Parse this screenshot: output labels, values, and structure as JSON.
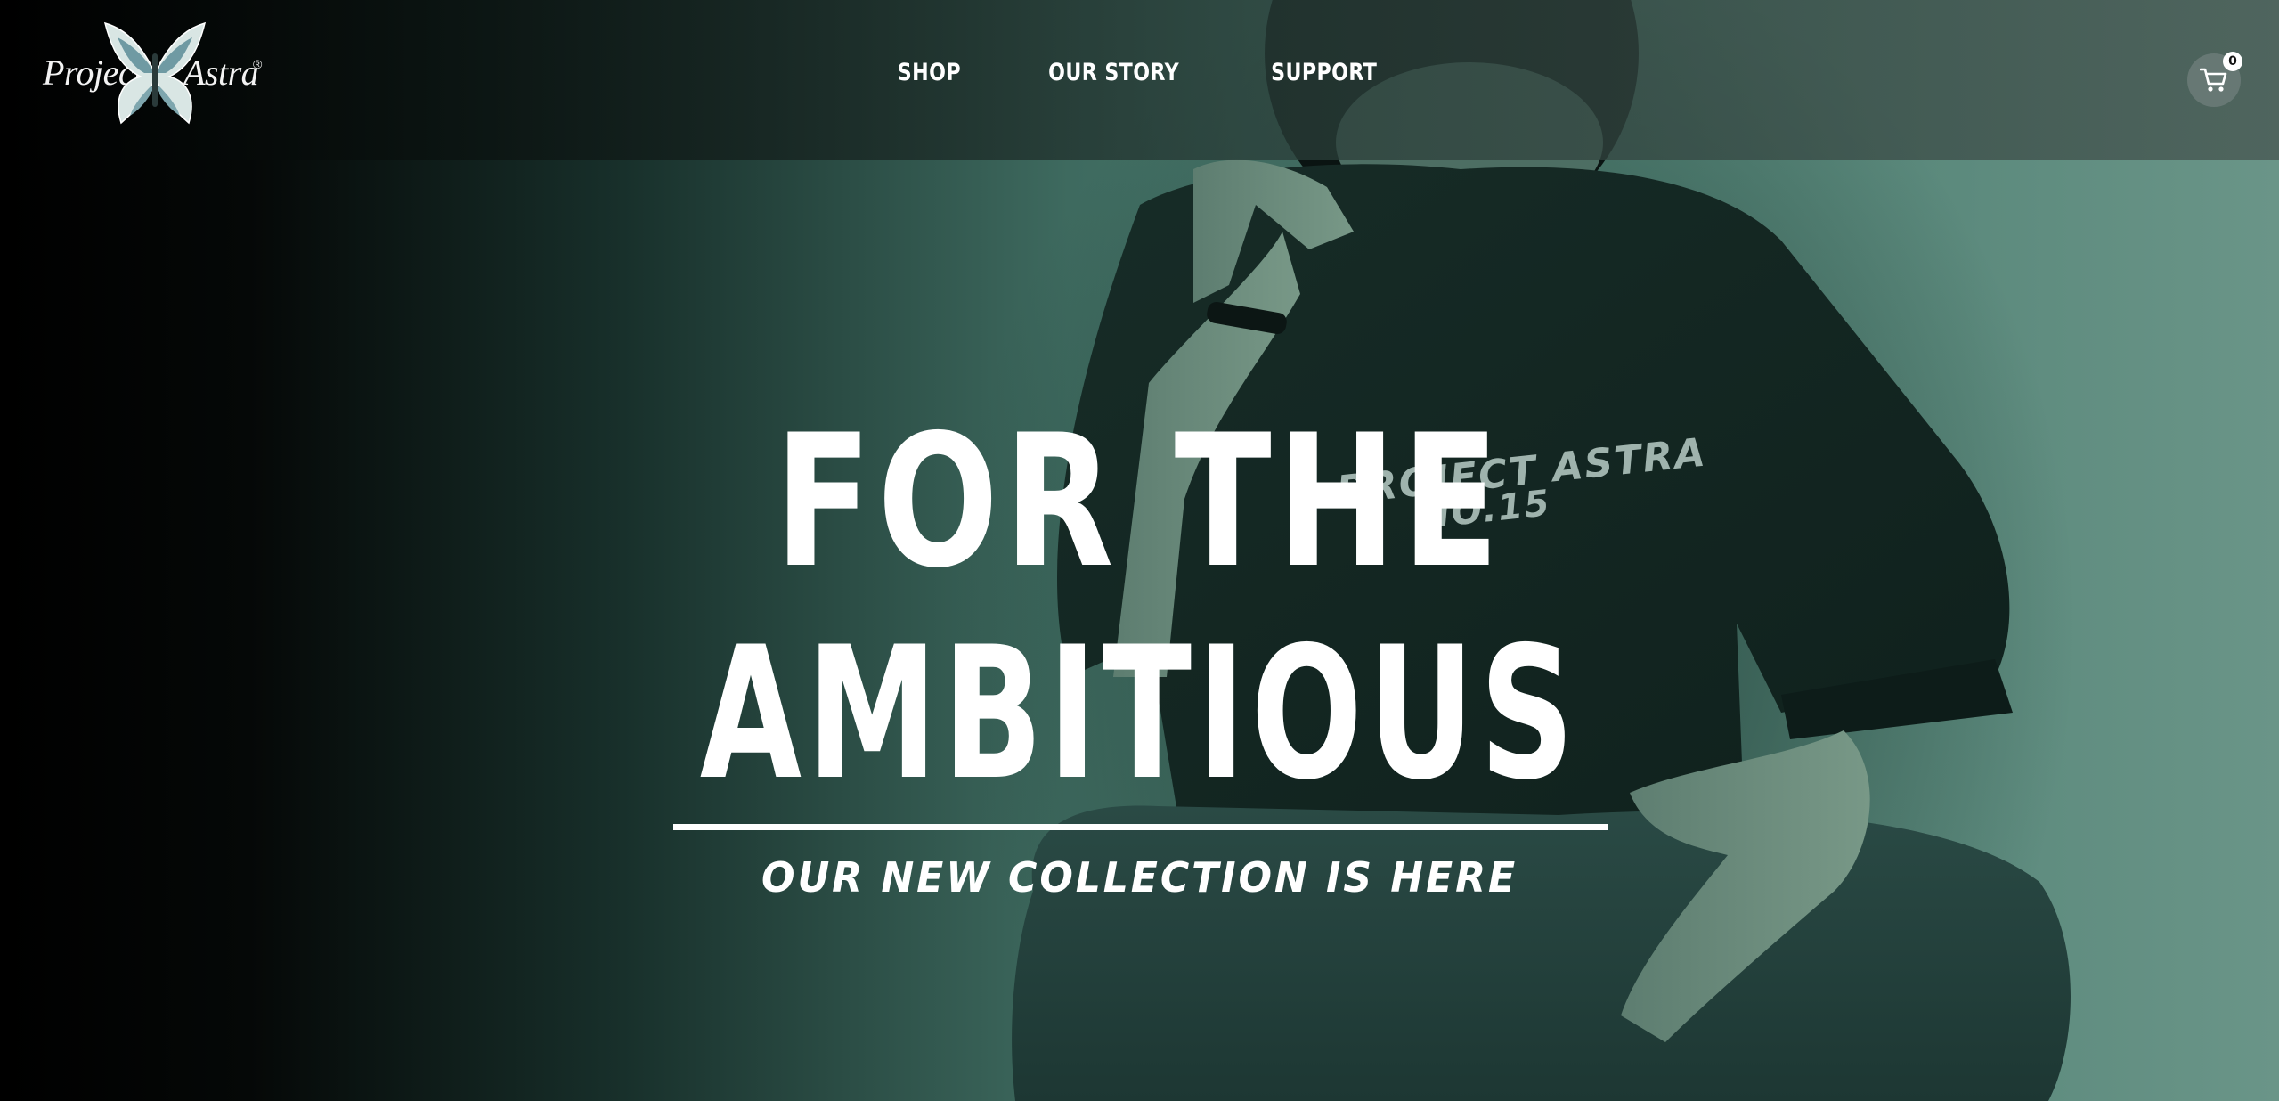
{
  "brand": {
    "logo_left": "Project",
    "logo_right": "Astra",
    "registered_mark": "®",
    "logo_icon": "butterfly-icon"
  },
  "nav": {
    "items": [
      {
        "label": "SHOP"
      },
      {
        "label": "OUR STORY"
      },
      {
        "label": "SUPPORT"
      }
    ]
  },
  "cart": {
    "icon": "cart-icon",
    "count": "0"
  },
  "hero": {
    "headline_line1": "FOR THE",
    "headline_line2": "AMBITIOUS",
    "subheadline": "OUR NEW COLLECTION IS HERE",
    "shirt_print_line1": "PROJECT ASTRA",
    "shirt_print_line2": "NO.15"
  },
  "colors": {
    "accent_text": "#ffffff",
    "hero_tint": "#4f7f72",
    "background": "#000000"
  }
}
